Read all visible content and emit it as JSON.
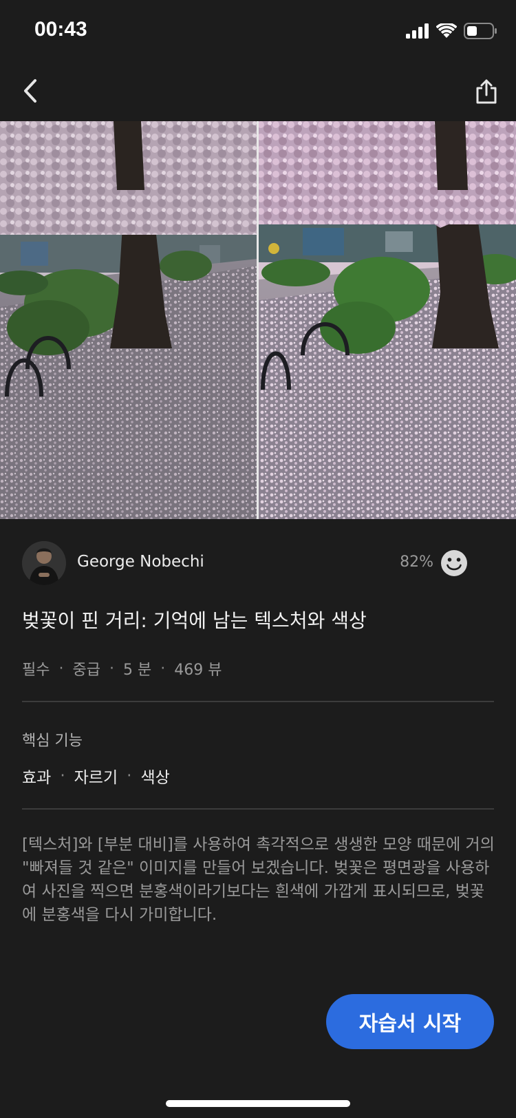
{
  "status_bar": {
    "time": "00:43",
    "icons": [
      "cellular-signal-icon",
      "wifi-icon",
      "battery-icon"
    ]
  },
  "nav": {
    "back_icon": "chevron-left-icon",
    "share_icon": "share-icon"
  },
  "hero": {
    "description_icon": "cherry-blossom-before-after-photo"
  },
  "author": {
    "name": "George Nobechi",
    "rating": "82%",
    "rating_icon": "smiley-icon"
  },
  "tutorial": {
    "title": "벚꽃이 핀 거리: 기억에 남는 텍스처와 색상",
    "meta": [
      "필수",
      "중급",
      "5 분",
      "469 뷰"
    ],
    "separator": "·",
    "key_features_label": "핵심 기능",
    "key_features": [
      "효과",
      "자르기",
      "색상"
    ],
    "description": "[텍스처]와 [부분 대비]를 사용하여 촉각적으로 생생한 모양 때문에 거의 \"빠져들 것 같은\" 이미지를 만들어 보겠습니다. 벚꽃은 평면광을 사용하여 사진을 찍으면 분홍색이라기보다는 흰색에 가깝게 표시되므로, 벚꽃에 분홍색을 다시 가미합니다.",
    "start_button": "자습서 시작"
  },
  "colors": {
    "background": "#1c1c1c",
    "accent": "#2c6cdf",
    "text_primary": "#ececec",
    "text_secondary": "#9a9a9a"
  }
}
